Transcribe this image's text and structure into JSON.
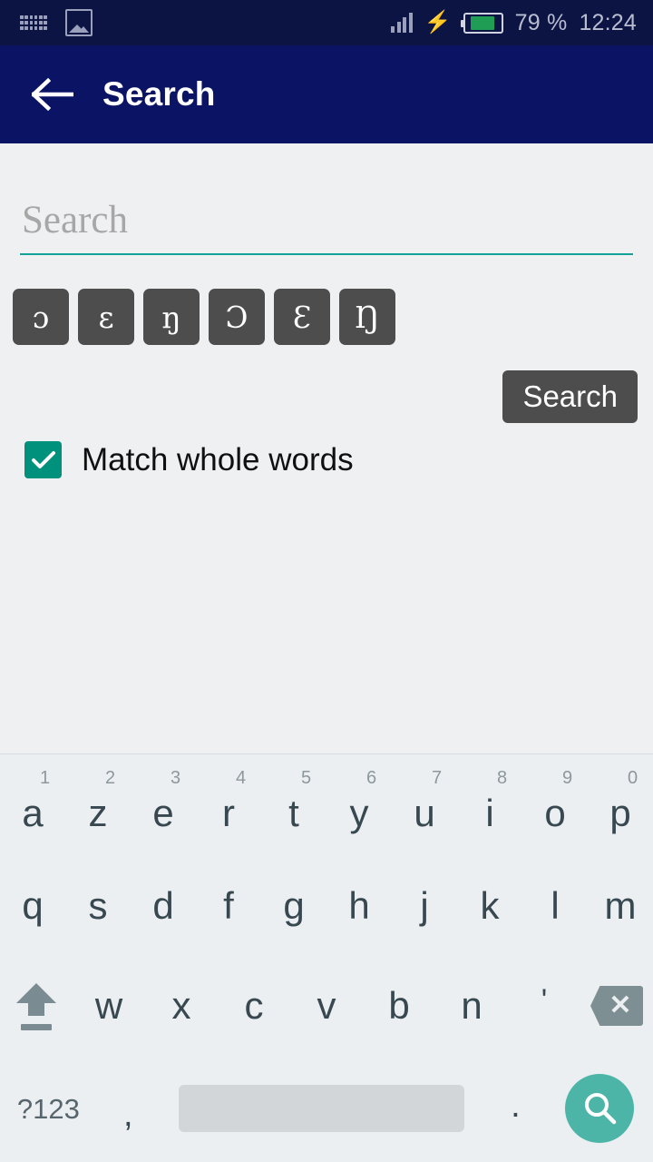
{
  "status_bar": {
    "icons": [
      "keyboard-icon",
      "image-icon",
      "signal-icon",
      "charging-bolt-icon",
      "battery-icon"
    ],
    "battery_percent": "79 %",
    "battery_level": 72,
    "time": "12:24",
    "background_color": "#0c1444",
    "icon_color": "#9aa0bb",
    "battery_fill_color": "#1f9d55"
  },
  "app_bar": {
    "back_icon": "arrow-left-icon",
    "title": "Search",
    "background_color": "#0b1464",
    "text_color": "#ffffff"
  },
  "search_form": {
    "input_value": "",
    "input_placeholder": "Search",
    "underline_color": "#12a39a",
    "special_chars": [
      {
        "label": "ɔ"
      },
      {
        "label": "ɛ"
      },
      {
        "label": "ŋ"
      },
      {
        "label": "Ɔ"
      },
      {
        "label": "Ɛ"
      },
      {
        "label": "Ŋ"
      }
    ],
    "special_key_color": "#4d4d4d",
    "search_button_label": "Search",
    "search_button_color": "#4d4d4d",
    "match_whole_words_label": "Match whole words",
    "match_whole_words_checked": true,
    "checkbox_color": "#00917c"
  },
  "keyboard": {
    "layout": "AZERTY",
    "background_color": "#eceff1",
    "key_text_color": "#374850",
    "digit_text_color": "#8d989d",
    "row1": [
      {
        "letter": "a",
        "digit": "1"
      },
      {
        "letter": "z",
        "digit": "2"
      },
      {
        "letter": "e",
        "digit": "3"
      },
      {
        "letter": "r",
        "digit": "4"
      },
      {
        "letter": "t",
        "digit": "5"
      },
      {
        "letter": "y",
        "digit": "6"
      },
      {
        "letter": "u",
        "digit": "7"
      },
      {
        "letter": "i",
        "digit": "8"
      },
      {
        "letter": "o",
        "digit": "9"
      },
      {
        "letter": "p",
        "digit": "0"
      }
    ],
    "row2": [
      {
        "letter": "q"
      },
      {
        "letter": "s"
      },
      {
        "letter": "d"
      },
      {
        "letter": "f"
      },
      {
        "letter": "g"
      },
      {
        "letter": "h"
      },
      {
        "letter": "j"
      },
      {
        "letter": "k"
      },
      {
        "letter": "l"
      },
      {
        "letter": "m"
      }
    ],
    "row3": [
      {
        "letter": "w"
      },
      {
        "letter": "x"
      },
      {
        "letter": "c"
      },
      {
        "letter": "v"
      },
      {
        "letter": "b"
      },
      {
        "letter": "n"
      },
      {
        "letter": "'"
      }
    ],
    "shift_icon": "shift-arrow-icon",
    "backspace_icon": "backspace-delete-icon",
    "symbols_key_label": "?123",
    "comma_key_label": ",",
    "space_key_label": "",
    "period_key_label": ".",
    "enter_search_icon": "magnifier-icon",
    "enter_button_color": "#4cb5a7"
  }
}
